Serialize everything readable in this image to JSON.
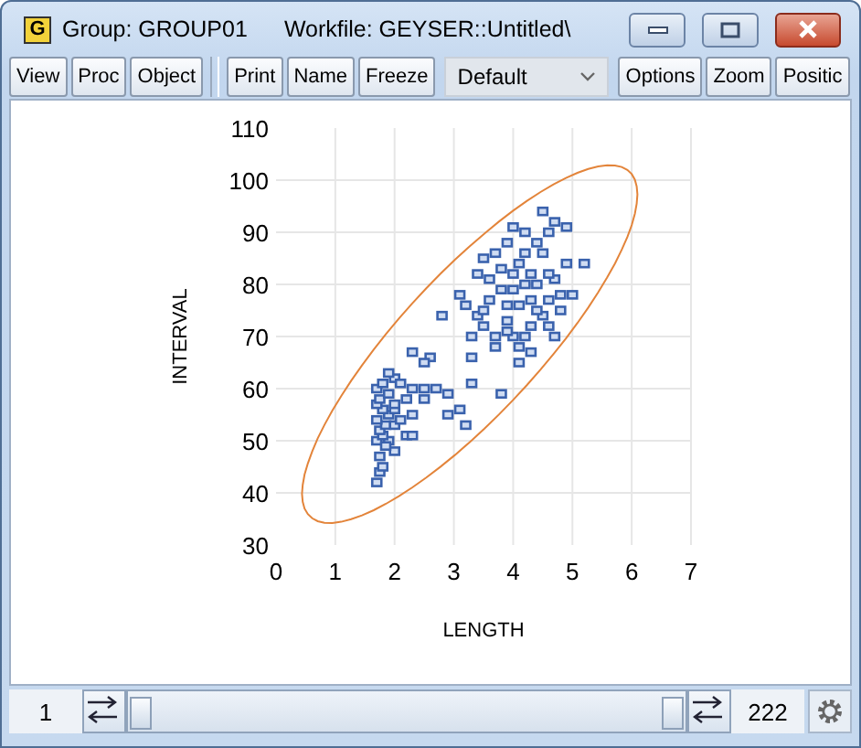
{
  "window": {
    "icon_letter": "G",
    "title": "Group: GROUP01",
    "workfile": "Workfile: GEYSER::Untitled\\"
  },
  "toolbar": [
    {
      "kind": "button",
      "label": "View"
    },
    {
      "kind": "button",
      "label": "Proc"
    },
    {
      "kind": "button",
      "label": "Object"
    },
    {
      "kind": "separator"
    },
    {
      "kind": "button",
      "label": "Print"
    },
    {
      "kind": "button",
      "label": "Name"
    },
    {
      "kind": "button",
      "label": "Freeze"
    },
    {
      "kind": "dropdown",
      "label": "Default"
    },
    {
      "kind": "button",
      "label": "Options"
    },
    {
      "kind": "button",
      "label": "Zoom"
    },
    {
      "kind": "button",
      "label": "Positic"
    }
  ],
  "chart": {
    "confidence_ellipse": true,
    "chart_data": {
      "type": "scatter",
      "xlabel": "LENGTH",
      "ylabel": "INTERVAL",
      "xlim": [
        0,
        7
      ],
      "ylim": [
        30,
        110
      ],
      "xticks": [
        0,
        1,
        2,
        3,
        4,
        5,
        6,
        7
      ],
      "yticks": [
        30,
        40,
        50,
        60,
        70,
        80,
        90,
        100,
        110
      ],
      "grid": true,
      "x": [
        1.7,
        1.75,
        1.8,
        1.75,
        2.0,
        1.9,
        1.7,
        1.8,
        2.2,
        2.3,
        1.75,
        1.85,
        2.0,
        2.1,
        1.7,
        1.9,
        2.3,
        1.8,
        2.0,
        1.7,
        2.2,
        1.75,
        1.9,
        2.3,
        1.7,
        1.8,
        2.0,
        2.1,
        2.5,
        2.5,
        2.7,
        2.9,
        2.9,
        3.1,
        3.2,
        3.3,
        3.3,
        2.6,
        2.5,
        2.3,
        3.8,
        4.1,
        1.9,
        2.0,
        1.85,
        3.7,
        3.7,
        4.0,
        4.2,
        4.6,
        4.3,
        4.5,
        3.9,
        3.5,
        3.4,
        3.2,
        3.1,
        3.6,
        3.9,
        4.1,
        4.3,
        4.6,
        4.8,
        5.0,
        3.8,
        4.0,
        4.2,
        4.4,
        4.7,
        3.6,
        3.4,
        3.8,
        4.0,
        4.3,
        4.6,
        5.2,
        4.9,
        4.1,
        3.5,
        3.7,
        4.2,
        4.5,
        3.9,
        4.4,
        4.2,
        4.6,
        4.7,
        4.9,
        4.0,
        4.5,
        2.8,
        3.3,
        3.5,
        4.4,
        4.8,
        3.9,
        4.1,
        4.7,
        4.3
      ],
      "series": [
        {
          "color": "#3a62ad",
          "values": [
            42,
            44,
            45,
            47,
            48,
            50,
            50,
            51,
            51,
            51,
            52,
            53,
            53,
            54,
            54,
            55,
            55,
            56,
            56,
            57,
            58,
            58,
            59,
            60,
            60,
            61,
            62,
            61,
            60,
            58,
            60,
            59,
            55,
            56,
            53,
            61,
            66,
            66,
            65,
            67,
            59,
            65,
            63,
            57,
            49,
            68,
            70,
            70,
            70,
            72,
            72,
            74,
            73,
            72,
            74,
            76,
            78,
            77,
            76,
            76,
            77,
            77,
            78,
            78,
            79,
            79,
            80,
            80,
            81,
            81,
            82,
            83,
            82,
            82,
            82,
            84,
            84,
            84,
            85,
            86,
            86,
            86,
            88,
            88,
            90,
            90,
            92,
            91,
            91,
            94,
            74,
            70,
            75,
            75,
            75,
            71,
            68,
            70,
            67
          ]
        }
      ]
    }
  },
  "sample_bar": {
    "start": "1",
    "end": "222"
  }
}
